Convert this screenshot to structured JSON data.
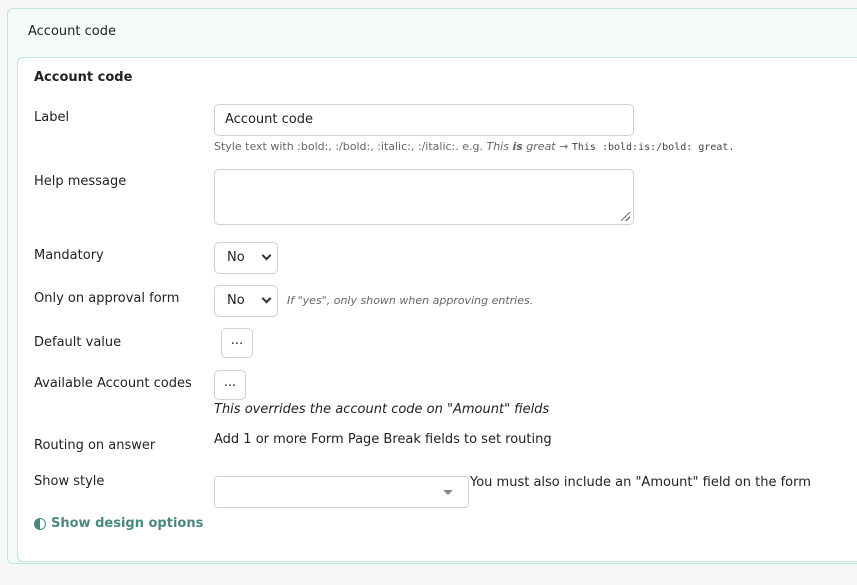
{
  "outer_title": "Account code",
  "section": {
    "title": "Account code"
  },
  "fields": {
    "label": {
      "label": "Label",
      "value": "Account code",
      "hint_prefix": "Style text with :bold:, :/bold:, :italic:, :/italic:. e.g.",
      "hint_example_a": "This",
      "hint_example_b": "is",
      "hint_example_c": "great",
      "hint_arrow": "→",
      "hint_code": "This :bold:is:/bold: great."
    },
    "help_message": {
      "label": "Help message",
      "value": ""
    },
    "mandatory": {
      "label": "Mandatory",
      "value": "No"
    },
    "only_on_approval": {
      "label": "Only on approval form",
      "value": "No",
      "note": "If \"yes\", only shown when approving entries."
    },
    "default_value": {
      "label": "Default value",
      "button": "..."
    },
    "available_codes": {
      "label": "Available Account codes",
      "button": "...",
      "note": "This overrides the account code on \"Amount\" fields"
    },
    "routing": {
      "label": "Routing on answer",
      "text": "Add 1 or more Form Page Break fields to set routing"
    },
    "show_style": {
      "label": "Show style",
      "value": "",
      "note": "You must also include an \"Amount\" field on the form"
    }
  },
  "design_options": {
    "icon": "half-circle-icon",
    "label": "Show design options"
  }
}
